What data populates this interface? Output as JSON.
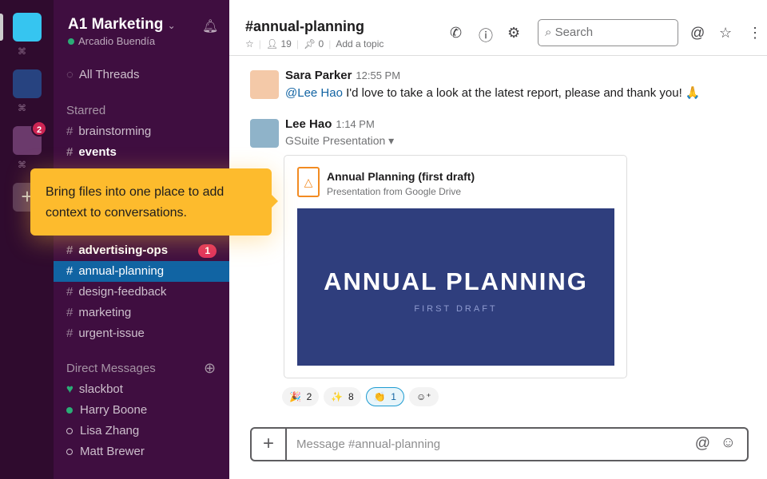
{
  "workspaces": [
    {
      "color": "#36c5f0"
    },
    {
      "color": "#274380"
    },
    {
      "color": "#6b3a6c",
      "badge": "2"
    }
  ],
  "workspace_shortcut_glyph": "⌘",
  "sidebar": {
    "team": "A1 Marketing",
    "user": "Arcadio Buendía",
    "all_threads": "All Threads",
    "starred_label": "Starred",
    "starred": [
      {
        "name": "brainstorming",
        "bold": false
      },
      {
        "name": "events",
        "bold": true
      }
    ],
    "channels": [
      {
        "name": "advertising-ops",
        "bold": true,
        "count": "1"
      },
      {
        "name": "annual-planning",
        "selected": true
      },
      {
        "name": "design-feedback"
      },
      {
        "name": "marketing"
      },
      {
        "name": "urgent-issue"
      }
    ],
    "dm_label": "Direct Messages",
    "dms": [
      {
        "name": "slackbot",
        "status": "heart"
      },
      {
        "name": "Harry Boone",
        "status": "online"
      },
      {
        "name": "Lisa Zhang",
        "status": "away"
      },
      {
        "name": "Matt Brewer",
        "status": "away"
      }
    ]
  },
  "tooltip": "Bring files into one place to add context to conversations.",
  "header": {
    "channel": "#annual-planning",
    "members": "19",
    "pins": "0",
    "topic": "Add a topic",
    "search_placeholder": "Search"
  },
  "messages": [
    {
      "author": "Sara Parker",
      "time": "12:55 PM",
      "mention": "@Lee Hao",
      "text": " I'd love to take a look at the latest report, please and thank you! 🙏"
    },
    {
      "author": "Lee Hao",
      "time": "1:14 PM",
      "subtitle": "GSuite Presentation ▾",
      "attachment": {
        "title": "Annual Planning (first draft)",
        "source": "Presentation from Google Drive",
        "slide_title": "ANNUAL PLANNING",
        "slide_subtitle": "FIRST DRAFT"
      }
    }
  ],
  "reactions": [
    {
      "emoji": "🎉",
      "count": "2"
    },
    {
      "emoji": "✨",
      "count": "8"
    },
    {
      "emoji": "👏",
      "count": "1",
      "active": true
    }
  ],
  "composer": {
    "placeholder": "Message #annual-planning"
  },
  "colors": {
    "sidebar": "#3f0e40",
    "selected": "#1164a3",
    "tooltip": "#fdbb2d",
    "slide": "#2f3e7d"
  }
}
